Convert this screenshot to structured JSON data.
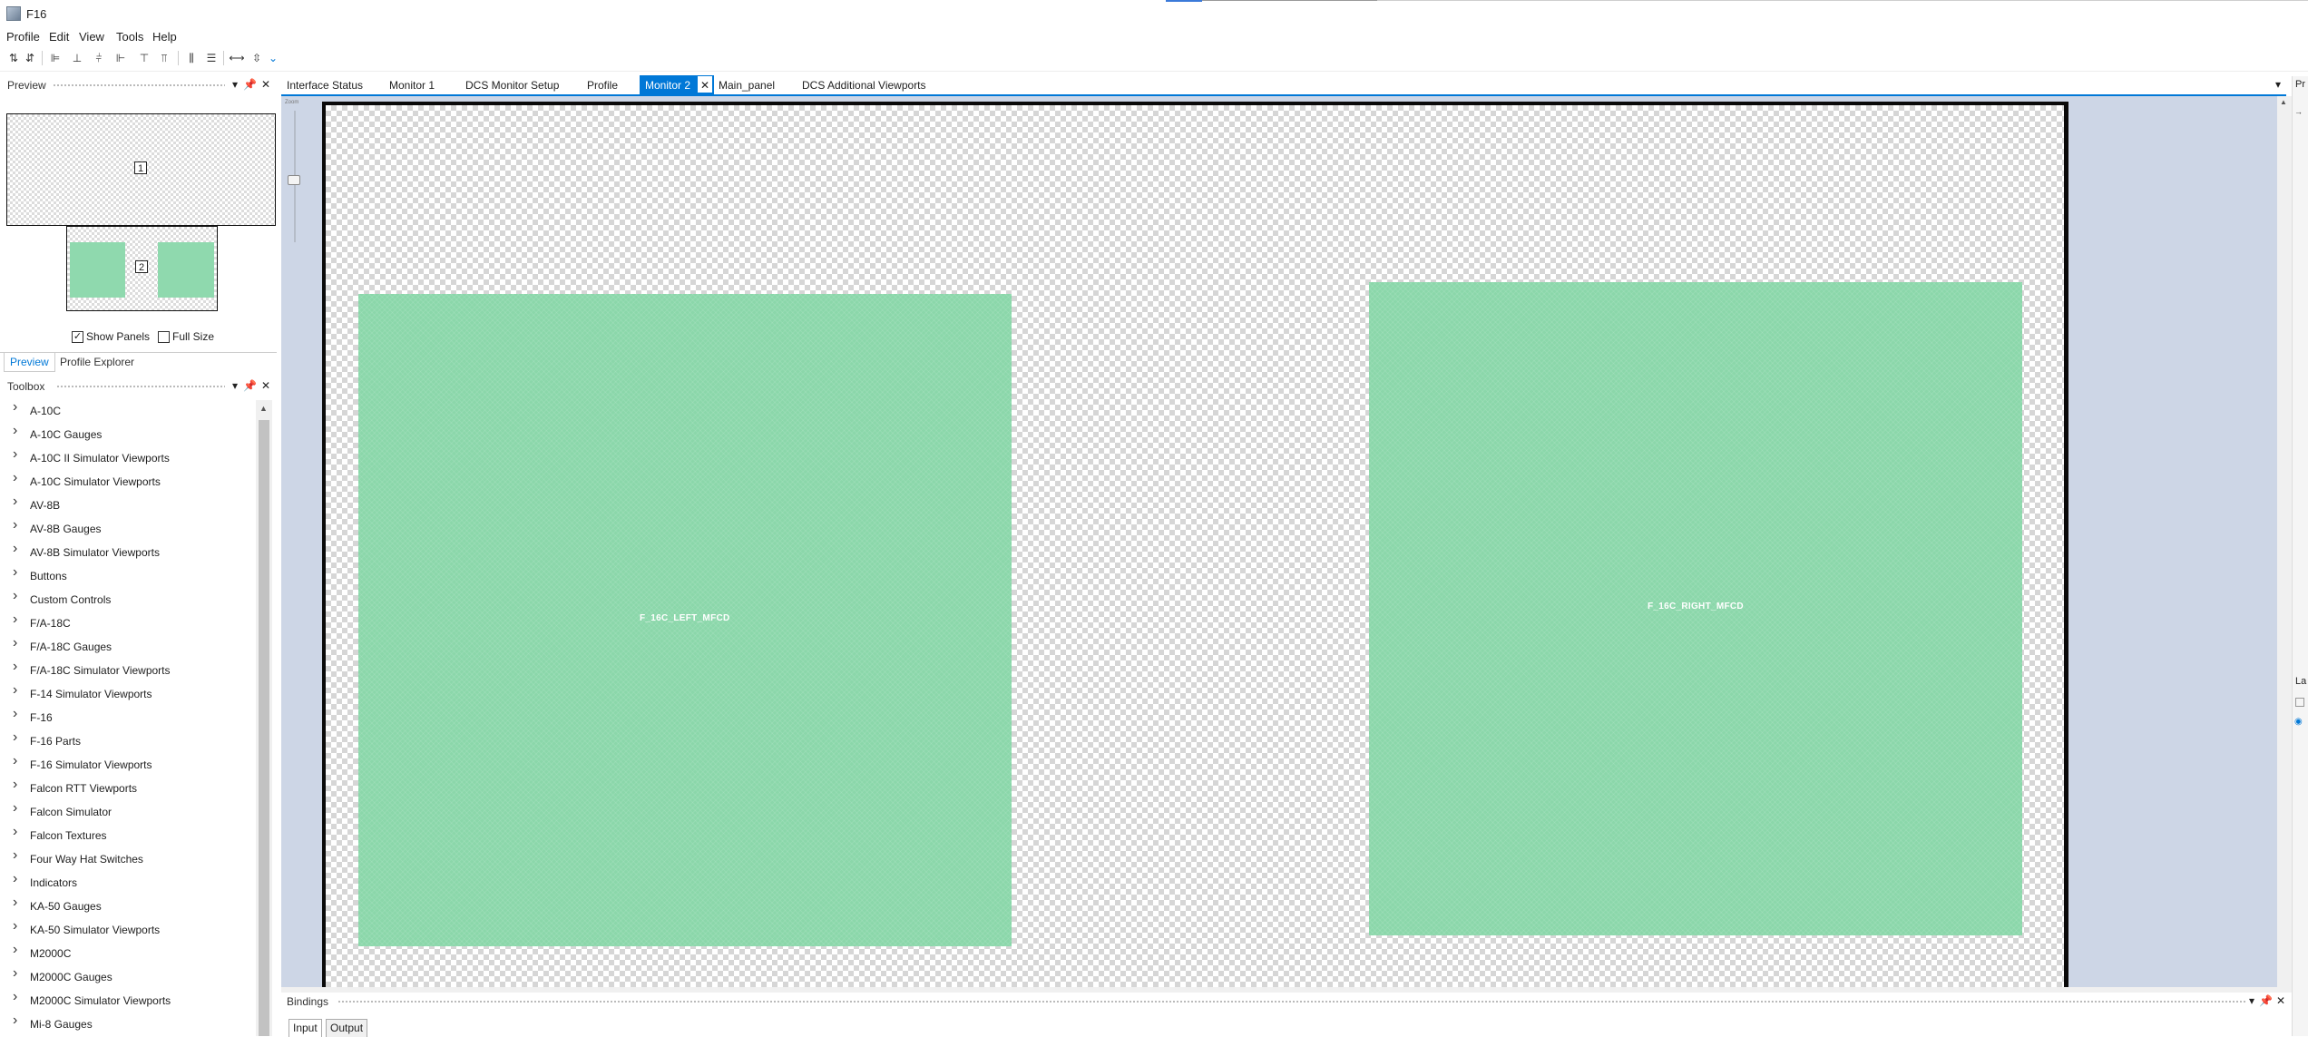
{
  "window": {
    "title": "F16"
  },
  "menu": [
    "Profile",
    "Edit",
    "View",
    "Tools",
    "Help"
  ],
  "preview_panel": {
    "title": "Preview",
    "monitor1_number": "1",
    "monitor2_number": "2",
    "show_panels_label": "Show Panels",
    "show_panels_checked": true,
    "full_size_label": "Full Size",
    "full_size_checked": false,
    "tabs": [
      "Preview",
      "Profile Explorer"
    ],
    "active_tab": "Preview"
  },
  "toolbox": {
    "title": "Toolbox",
    "items": [
      "A-10C",
      "A-10C Gauges",
      "A-10C II Simulator Viewports",
      "A-10C Simulator Viewports",
      "AV-8B",
      "AV-8B Gauges",
      "AV-8B Simulator Viewports",
      "Buttons",
      "Custom Controls",
      "F/A-18C",
      "F/A-18C Gauges",
      "F/A-18C Simulator Viewports",
      "F-14 Simulator Viewports",
      "F-16",
      "F-16 Parts",
      "F-16 Simulator Viewports",
      "Falcon RTT Viewports",
      "Falcon Simulator",
      "Falcon Textures",
      "Four Way Hat Switches",
      "Indicators",
      "KA-50 Gauges",
      "KA-50 Simulator Viewports",
      "M2000C",
      "M2000C Gauges",
      "M2000C Simulator Viewports",
      "Mi-8 Gauges"
    ]
  },
  "document_tabs": [
    {
      "label": "Interface Status",
      "active": false
    },
    {
      "label": "Monitor 1",
      "active": false
    },
    {
      "label": "DCS Monitor Setup",
      "active": false
    },
    {
      "label": "Profile",
      "active": false
    },
    {
      "label": "Monitor 2",
      "active": true,
      "closable": true
    },
    {
      "label": "Main_panel",
      "active": false
    },
    {
      "label": "DCS Additional Viewports",
      "active": false
    }
  ],
  "canvas": {
    "zoom_label": "Zoom",
    "left_panel_label": "F_16C_LEFT_MFCD",
    "right_panel_label": "F_16C_RIGHT_MFCD"
  },
  "bindings_panel": {
    "title": "Bindings",
    "tabs": [
      "Input",
      "Output"
    ],
    "active_tab": "Input"
  },
  "right_dock": {
    "top_label": "Pr",
    "mid_label": "La"
  },
  "colors": {
    "accent": "#0078d7",
    "panel_green": "#8bd7aa",
    "doc_background": "#cdd6e6"
  }
}
